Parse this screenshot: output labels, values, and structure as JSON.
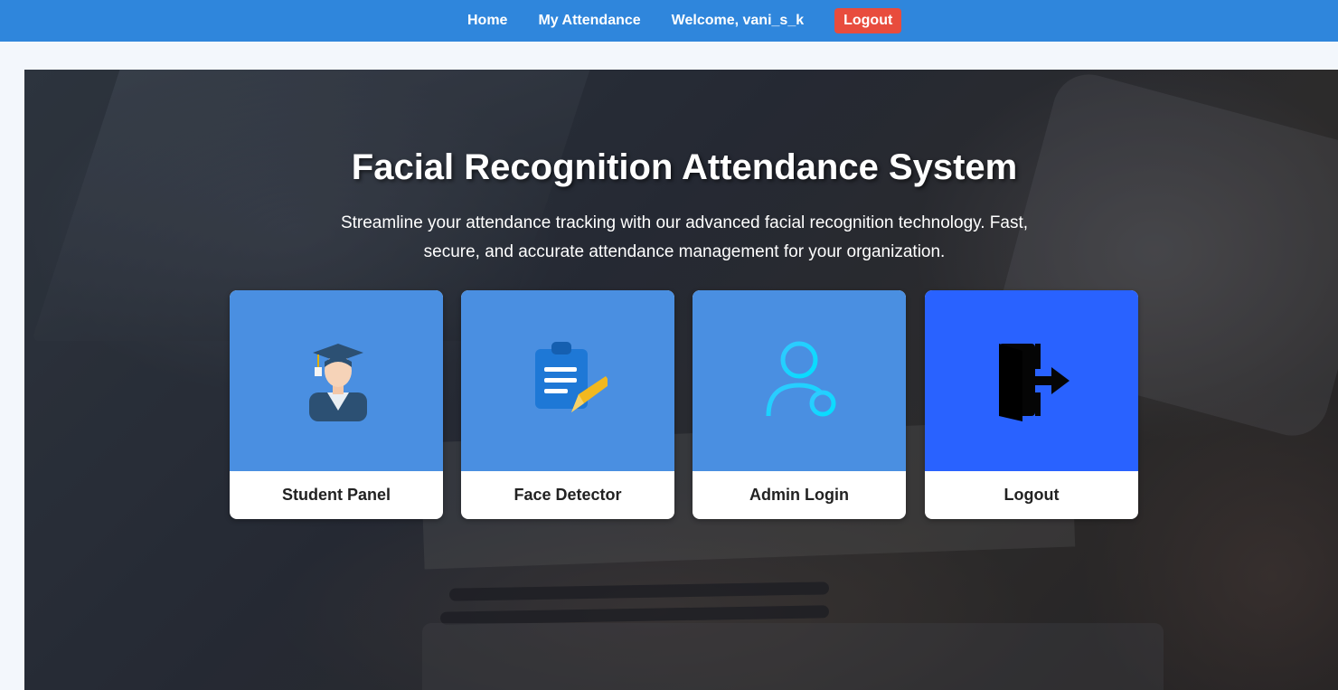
{
  "nav": {
    "home": "Home",
    "my_attendance": "My Attendance",
    "welcome": "Welcome, vani_s_k",
    "logout": "Logout"
  },
  "hero": {
    "title": "Facial Recognition Attendance System",
    "subtitle": "Streamline your attendance tracking with our advanced facial recognition technology. Fast, secure, and accurate attendance management for your organization."
  },
  "cards": [
    {
      "label": "Student Panel",
      "icon": "graduate-student-icon"
    },
    {
      "label": "Face Detector",
      "icon": "clipboard-pencil-icon"
    },
    {
      "label": "Admin Login",
      "icon": "user-key-icon"
    },
    {
      "label": "Logout",
      "icon": "door-exit-icon"
    }
  ],
  "colors": {
    "nav_bg": "#2f86dc",
    "logout_btn": "#e84c3d",
    "card_blue": "#4a8fe1",
    "logout_card": "#2962ff"
  }
}
